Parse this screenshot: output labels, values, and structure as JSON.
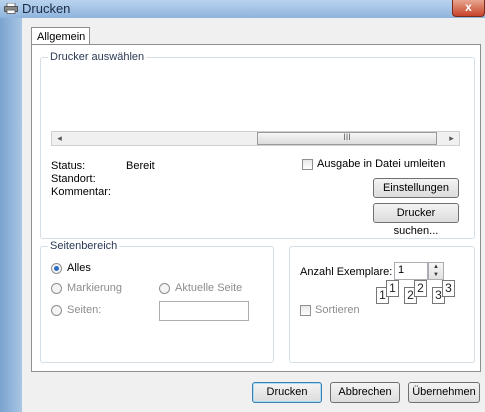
{
  "window": {
    "title": "Drucken",
    "close_glyph": "x"
  },
  "tabs": [
    {
      "label": "Allgemein"
    }
  ],
  "printer_group": {
    "legend": "Drucker auswählen",
    "scroll_thumb_grip": "III",
    "status_label": "Status:",
    "status_value": "Bereit",
    "location_label": "Standort:",
    "location_value": "",
    "comment_label": "Kommentar:",
    "comment_value": "",
    "print_to_file_label": "Ausgabe in Datei umleiten",
    "settings_button": "Einstellungen",
    "find_printer_button": "Drucker suchen..."
  },
  "page_range": {
    "legend": "Seitenbereich",
    "all_label": "Alles",
    "selection_label": "Markierung",
    "current_page_label": "Aktuelle Seite",
    "pages_label": "Seiten:",
    "pages_value": "",
    "selected": "all"
  },
  "copies": {
    "count_label": "Anzahl Exemplare:",
    "count_value": "1",
    "collate_label": "Sortieren",
    "collate_checked": false,
    "preview_pages": [
      "1",
      "1",
      "2",
      "2",
      "3",
      "3"
    ]
  },
  "buttons": {
    "print": "Drucken",
    "cancel": "Abbrechen",
    "apply": "Übernehmen"
  },
  "colors": {
    "accent": "#2c6bc7",
    "frame": "#6a97c4"
  }
}
